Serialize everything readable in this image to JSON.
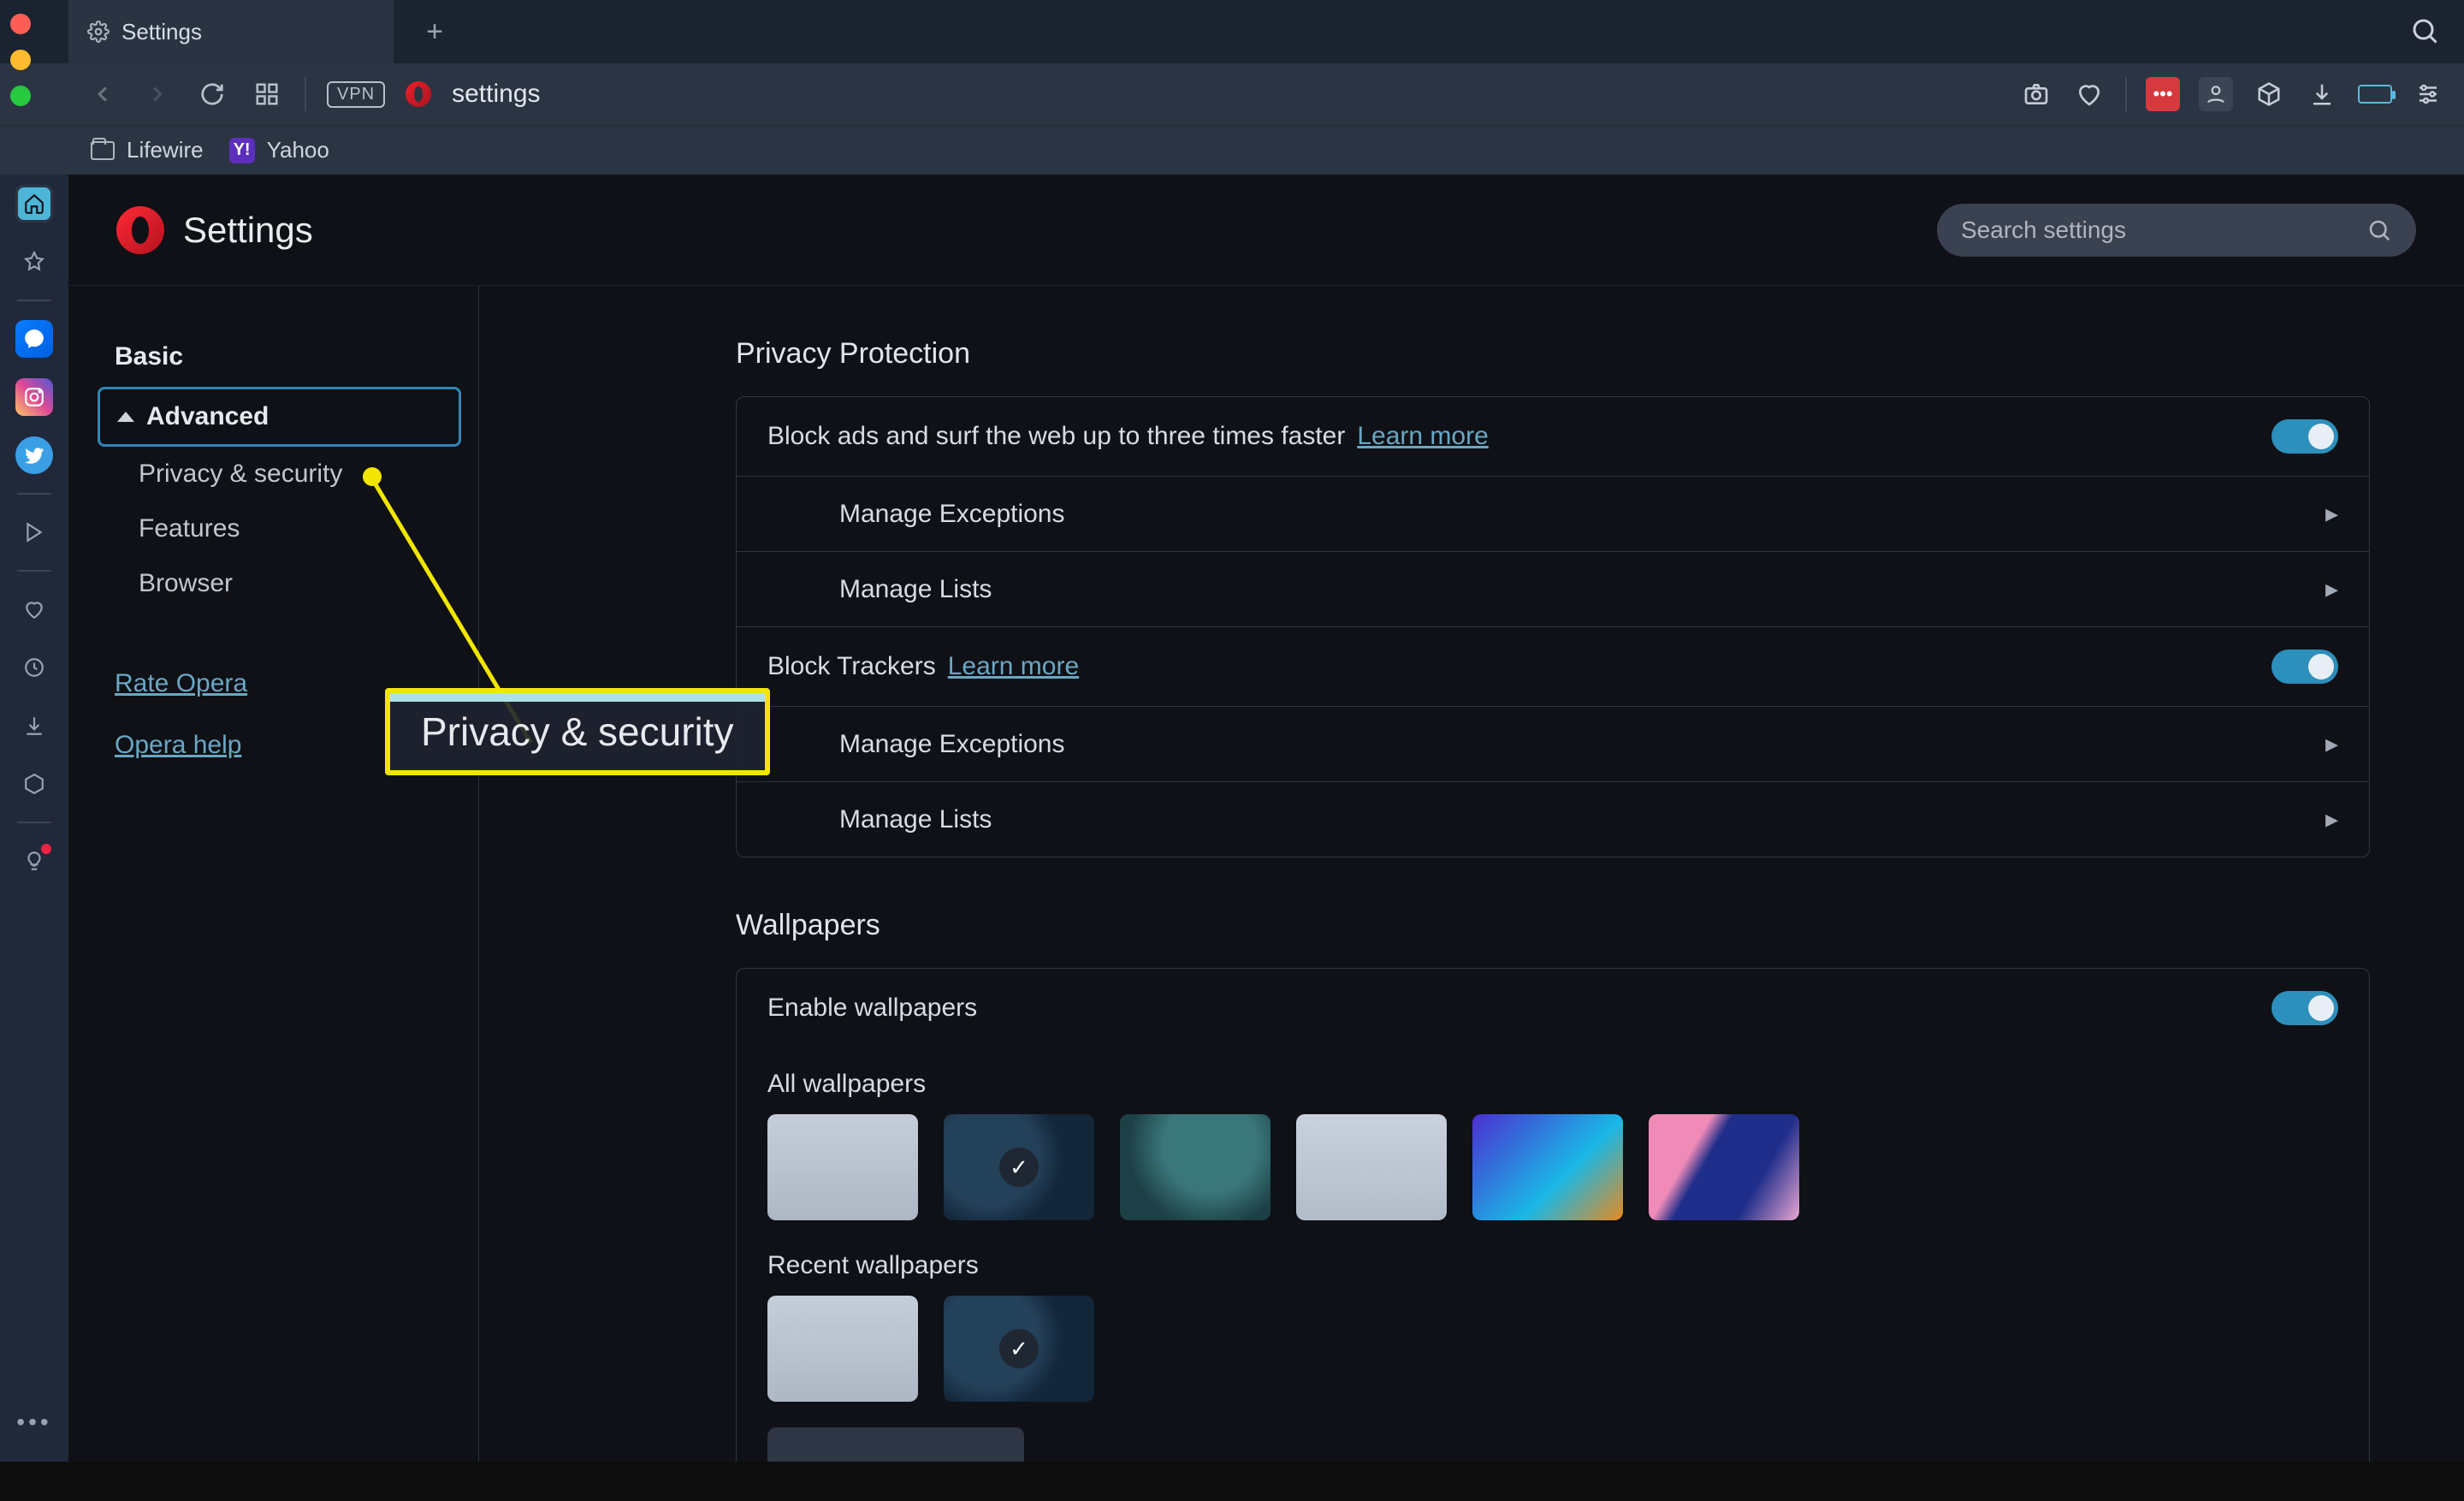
{
  "tab": {
    "title": "Settings"
  },
  "address": "settings",
  "bookmarks": [
    {
      "label": "Lifewire"
    },
    {
      "label": "Yahoo"
    }
  ],
  "settings": {
    "title": "Settings",
    "search_placeholder": "Search settings"
  },
  "sidebar": {
    "basic": "Basic",
    "advanced": "Advanced",
    "items": [
      {
        "label": "Privacy & security"
      },
      {
        "label": "Features"
      },
      {
        "label": "Browser"
      }
    ],
    "rate": "Rate Opera",
    "help": "Opera help"
  },
  "callout": "Privacy & security",
  "privacy": {
    "heading": "Privacy Protection",
    "blockads": "Block ads and surf the web up to three times faster",
    "learn": "Learn more",
    "manage_exceptions": "Manage Exceptions",
    "manage_lists": "Manage Lists",
    "block_trackers": "Block Trackers"
  },
  "wallpapers": {
    "heading": "Wallpapers",
    "enable": "Enable wallpapers",
    "all": "All wallpapers",
    "recent": "Recent wallpapers"
  },
  "vpn_label": "VPN"
}
